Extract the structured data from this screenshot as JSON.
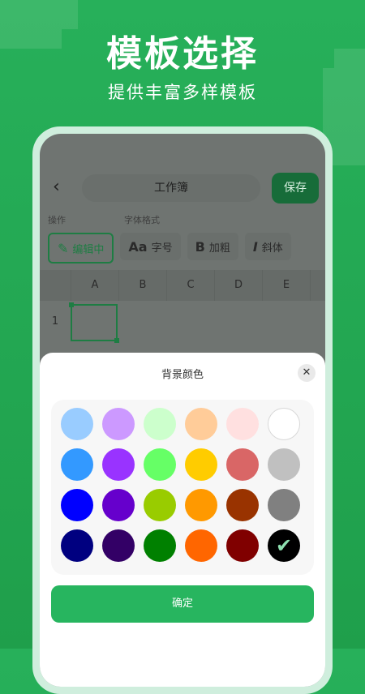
{
  "hero": {
    "title": "模板选择",
    "subtitle": "提供丰富多样模板"
  },
  "app": {
    "back_icon": "chevron-left-icon",
    "title": "工作簿",
    "save_label": "保存",
    "section_ops": "操作",
    "section_font": "字体格式",
    "tools": {
      "edit": "编辑中",
      "font_size": "字号",
      "bold": "加粗",
      "italic": "斜体"
    },
    "columns": [
      "A",
      "B",
      "C",
      "D",
      "E"
    ],
    "row_label": "1"
  },
  "sheet": {
    "title": "背景颜色",
    "close_icon": "close-icon",
    "confirm_label": "确定",
    "colors": [
      "#99ccff",
      "#cc99ff",
      "#ccffcc",
      "#ffcc99",
      "#ffe0e0",
      "#ffffff",
      "#3399ff",
      "#9933ff",
      "#66ff66",
      "#ffcc00",
      "#d96666",
      "#c0c0c0",
      "#0000ff",
      "#6600cc",
      "#99cc00",
      "#ff9900",
      "#993300",
      "#808080",
      "#000080",
      "#330066",
      "#008000",
      "#ff6600",
      "#800000",
      "#000000"
    ],
    "selected_index": 23
  }
}
